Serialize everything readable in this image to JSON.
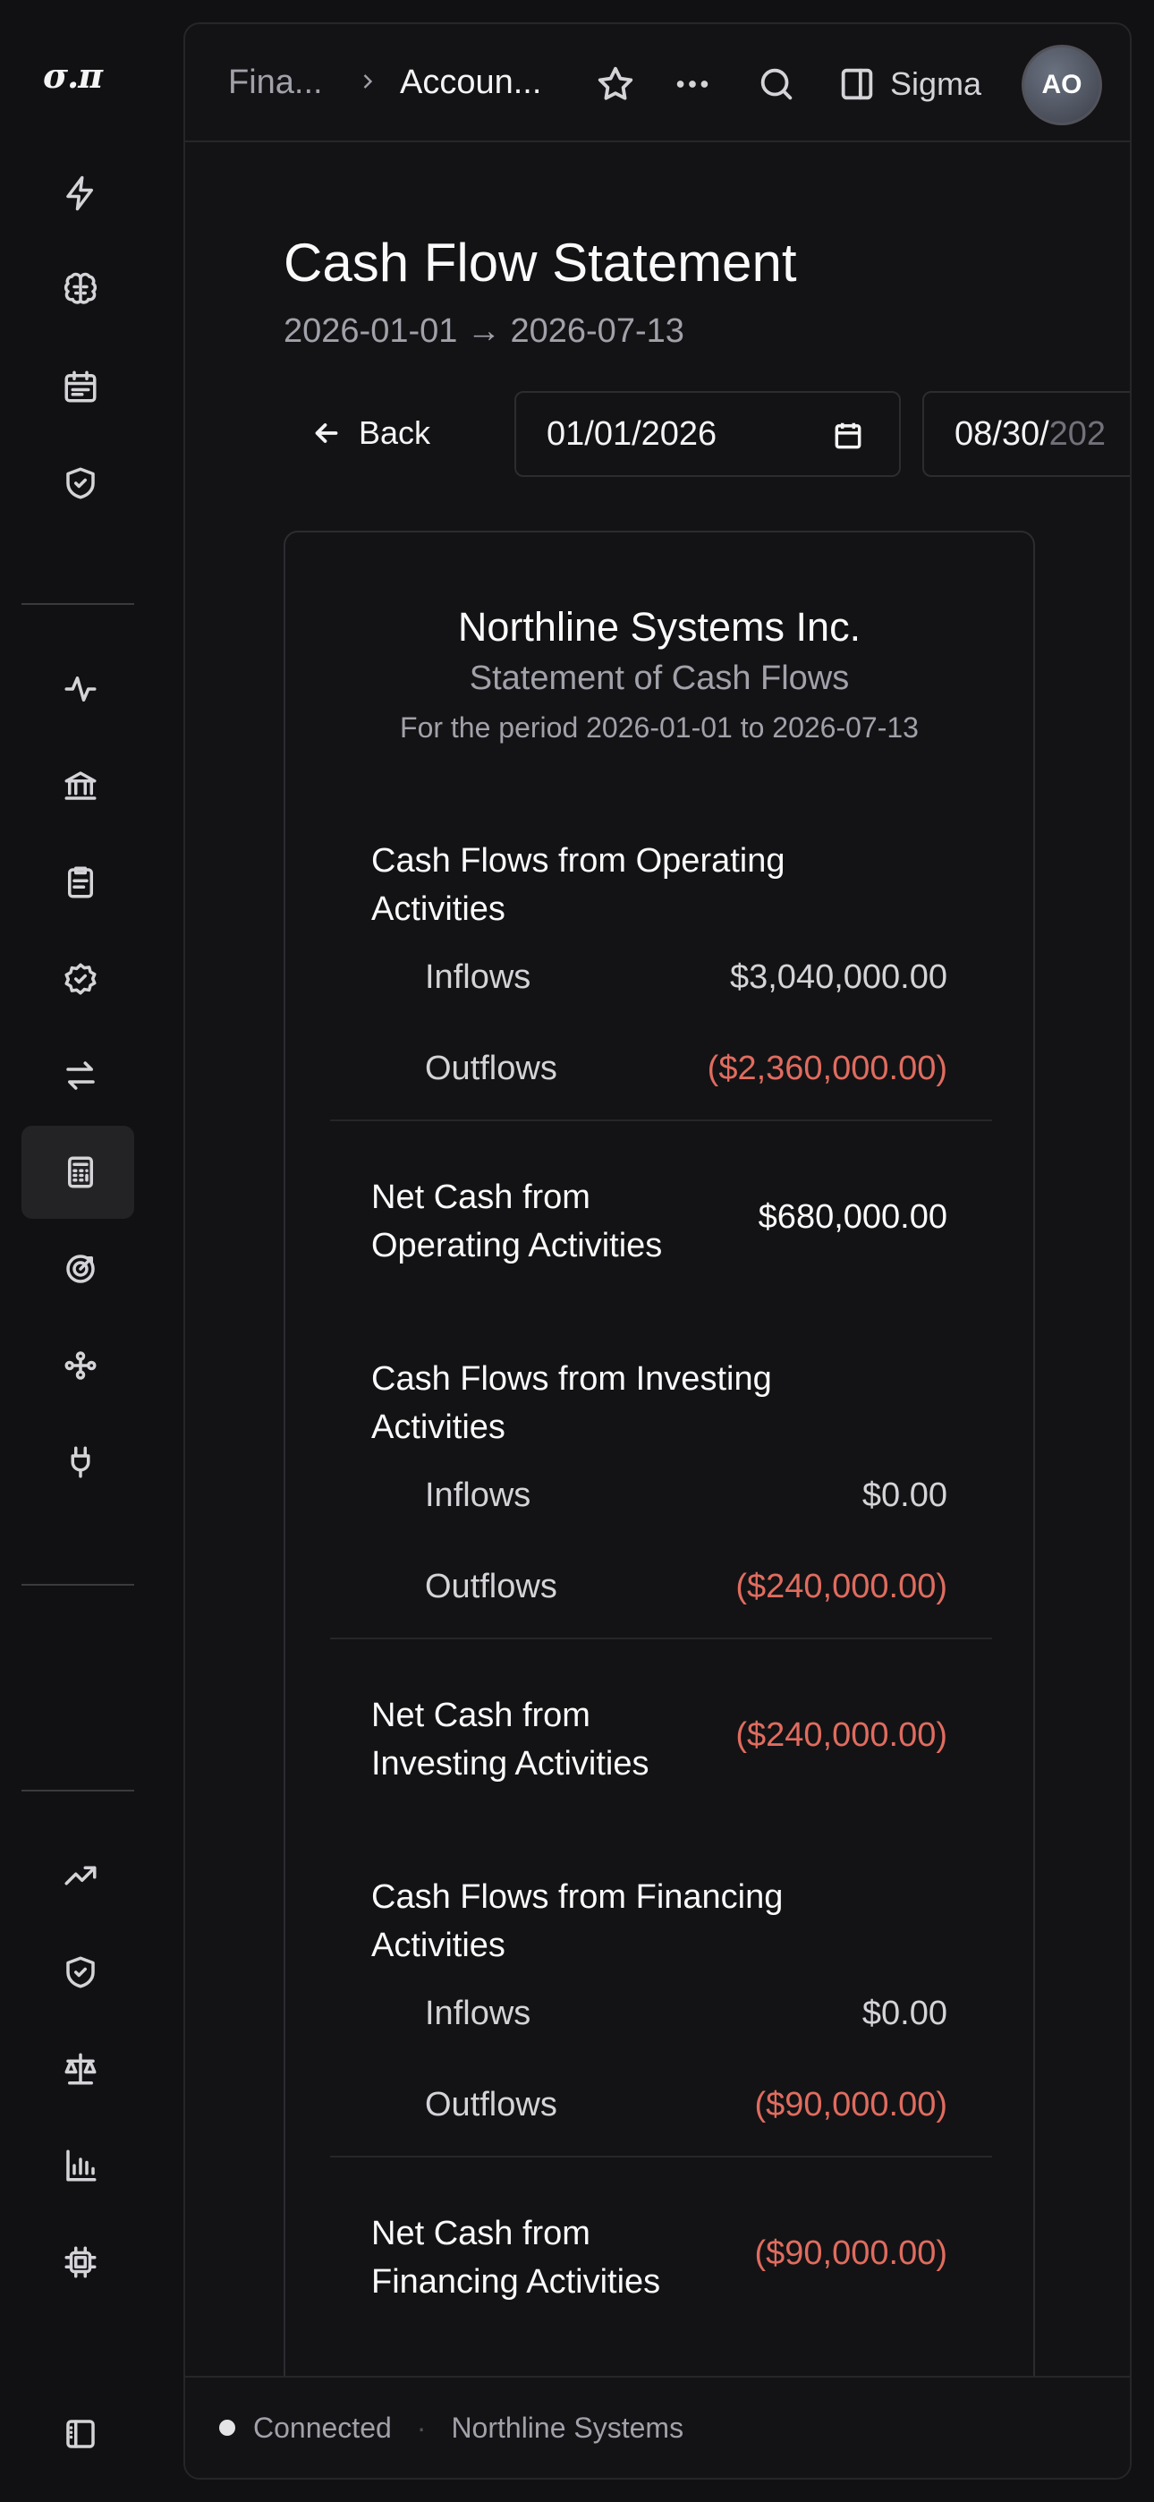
{
  "app": {
    "logo_text": "σ.π"
  },
  "rail": {
    "icons": [
      "bolt-icon",
      "brain-icon",
      "calendar-list-icon",
      "shield-check-icon",
      "activity-icon",
      "bank-icon",
      "clipboard-icon",
      "badge-check-icon",
      "arrows-exchange-icon",
      "calculator-icon",
      "target-icon",
      "workflow-icon",
      "plug-icon",
      "trending-up-icon",
      "shield-check-icon",
      "scale-icon",
      "bar-chart-icon",
      "chip-icon",
      "sidebar-toggle-icon"
    ],
    "active": "calculator-icon"
  },
  "topbar": {
    "breadcrumb_1": "Fina...",
    "breadcrumb_2": "Accoun...",
    "workspace_label": "Sigma",
    "avatar_initials": "AO"
  },
  "page": {
    "title": "Cash Flow Statement",
    "subtitle": "2026-01-01 → 2026-07-13"
  },
  "controls": {
    "back_label": "Back",
    "start_date": "01/01/2026",
    "end_date_visible": "08/30/",
    "end_date_faded": "202"
  },
  "statement": {
    "company": "Northline Systems Inc.",
    "title": "Statement of Cash Flows",
    "period": "For the period 2026-01-01 to 2026-07-13",
    "sections": [
      {
        "heading": "Cash Flows from Operating Activities",
        "inflows_label": "Inflows",
        "inflows_value": "$3,040,000.00",
        "outflows_label": "Outflows",
        "outflows_value": "($2,360,000.00)",
        "net_label": "Net Cash from Operating Activities",
        "net_value": "$680,000.00"
      },
      {
        "heading": "Cash Flows from Investing Activities",
        "inflows_label": "Inflows",
        "inflows_value": "$0.00",
        "outflows_label": "Outflows",
        "outflows_value": "($240,000.00)",
        "net_label": "Net Cash from Investing Activities",
        "net_value": "($240,000.00)"
      },
      {
        "heading": "Cash Flows from Financing Activities",
        "inflows_label": "Inflows",
        "inflows_value": "$0.00",
        "outflows_label": "Outflows",
        "outflows_value": "($90,000.00)",
        "net_label": "Net Cash from Financing Activities",
        "net_value": "($90,000.00)"
      }
    ]
  },
  "footer": {
    "status": "Connected",
    "org": "Northline Systems"
  },
  "colors": {
    "negative": "#e06c5f",
    "background": "#111113",
    "panel": "#131315"
  }
}
